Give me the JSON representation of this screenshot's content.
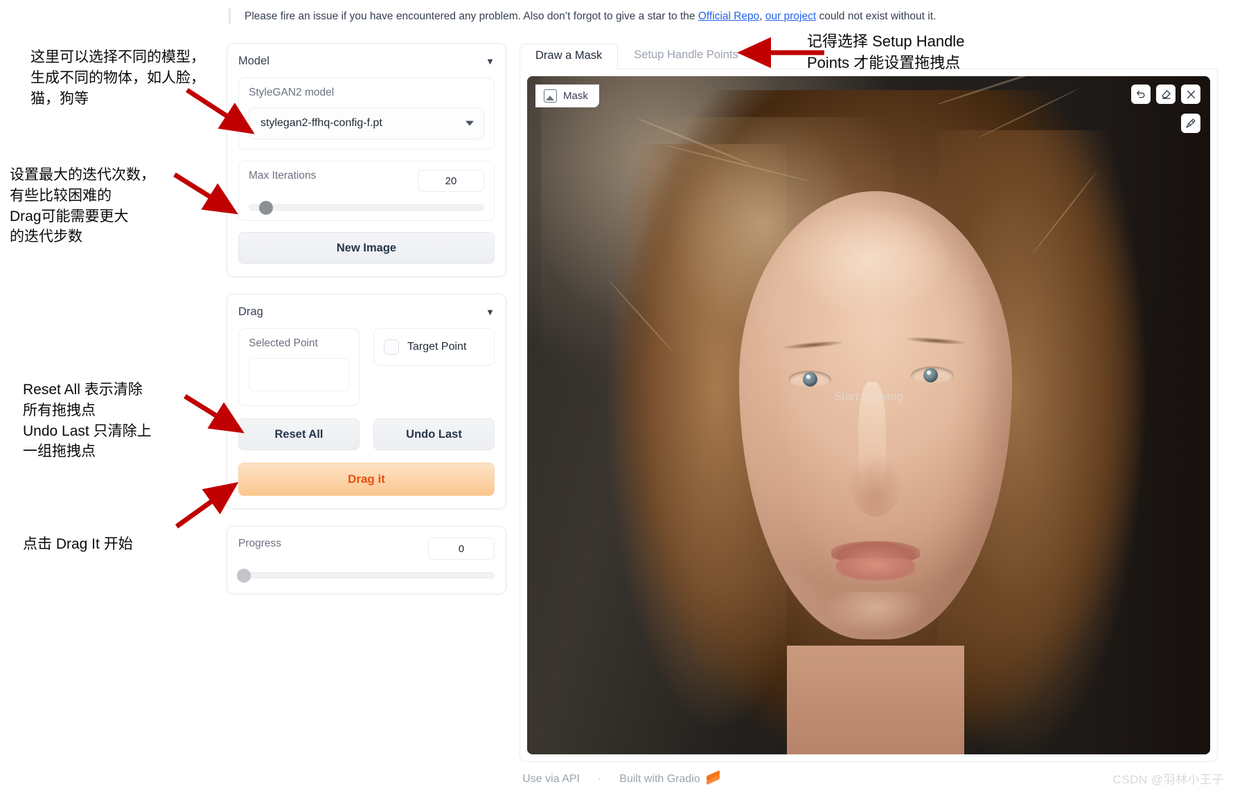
{
  "notice": {
    "text_before": "Please fire an issue if you have encountered any problem. Also don’t forgot to give a star to the ",
    "link1": "Official Repo",
    "between": ", ",
    "link2": "our project",
    "text_after": " could not exist without it."
  },
  "model_panel": {
    "title": "Model",
    "caret": "▼",
    "model_label": "StyleGAN2 model",
    "model_value": "stylegan2-ffhq-config-f.pt",
    "max_iter_label": "Max Iterations",
    "max_iter_value": "20",
    "new_image_label": "New Image"
  },
  "drag_panel": {
    "title": "Drag",
    "caret": "▼",
    "selected_point_label": "Selected Point",
    "selected_point_value": "",
    "target_point_label": "Target Point",
    "reset_all_label": "Reset All",
    "undo_last_label": "Undo Last",
    "drag_it_label": "Drag it"
  },
  "progress_panel": {
    "label": "Progress",
    "value": "0"
  },
  "tabs": [
    {
      "label": "Draw a Mask",
      "active": true
    },
    {
      "label": "Setup Handle Points",
      "active": false
    }
  ],
  "canvas": {
    "mask_chip_label": "Mask",
    "placeholder": "Start drawing",
    "tools": [
      "undo-icon",
      "eraser-icon",
      "close-icon",
      "brush-icon"
    ]
  },
  "footer": {
    "use_via_api": "Use via API",
    "separator": "·",
    "built_with": "Built with Gradio",
    "watermark": "CSDN @羽林小王子"
  },
  "annotations": {
    "a": "这里可以选择不同的模型，生成不同的物体，如人脸，猫，狗等",
    "b": "设置最大的迭代次数，\n有些比较困难的\nDrag可能需要更大\n的迭代步数",
    "c": "Reset All 表示清除\n所有拖拽点\nUndo Last 只清除上\n一组拖拽点",
    "d": "点击 Drag It 开始",
    "e": "记得选择 Setup Handle\nPoints 才能设置拖拽点"
  },
  "colors": {
    "accent_orange": "#e8500f",
    "link_blue": "#2563eb",
    "arrow_red": "#c00000"
  }
}
